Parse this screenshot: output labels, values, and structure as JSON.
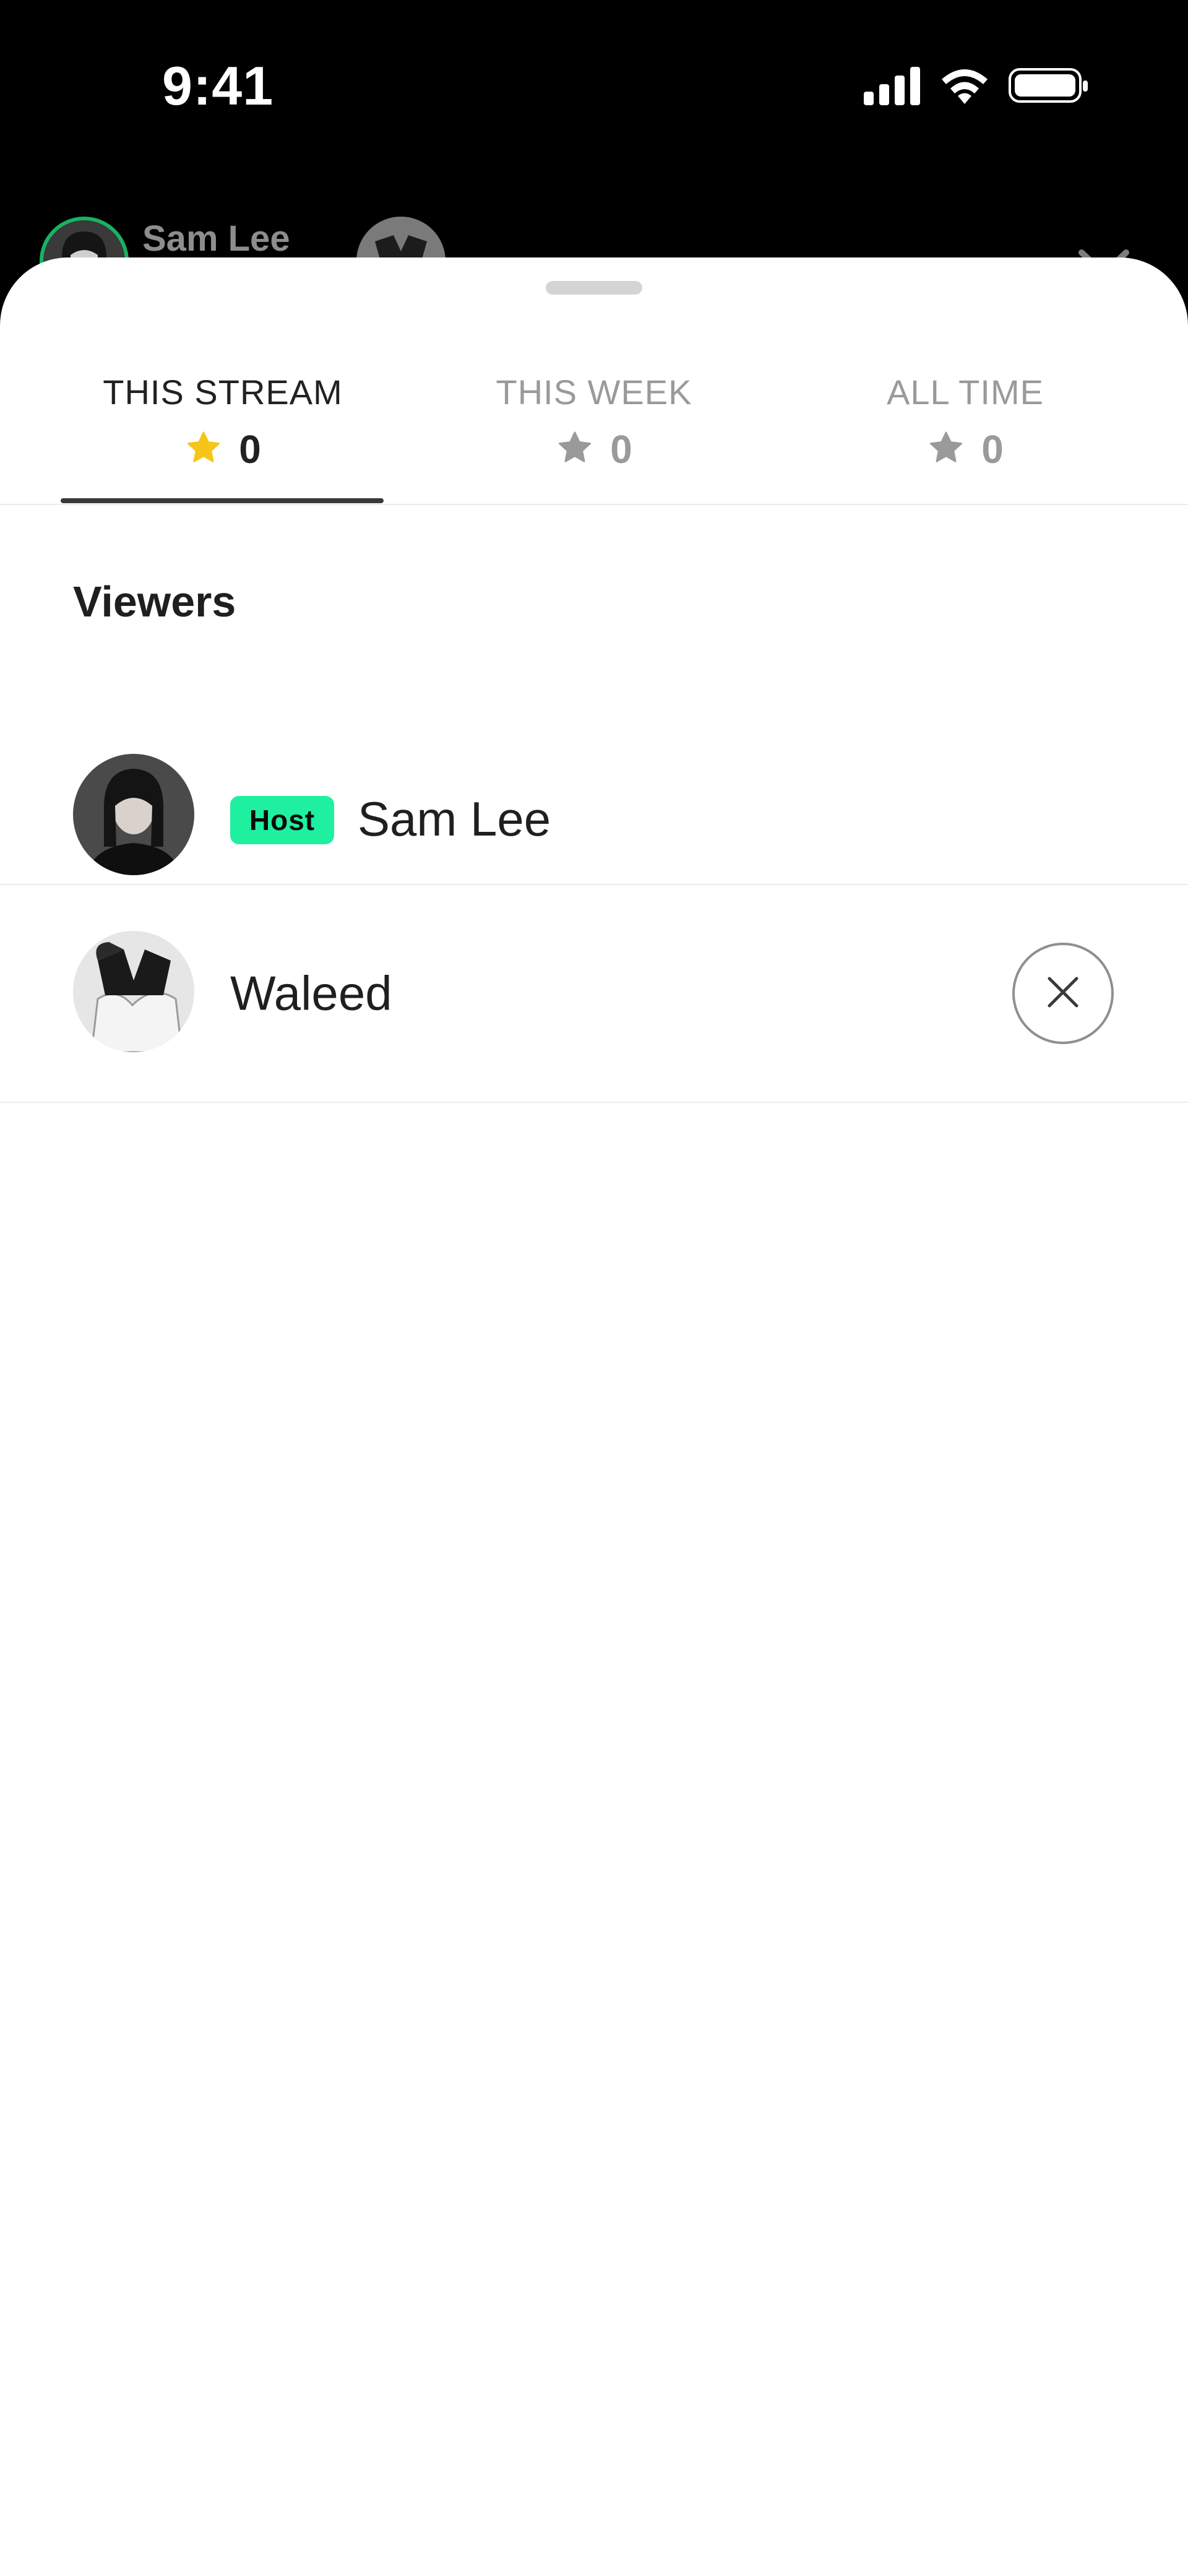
{
  "status_bar": {
    "time": "9:41",
    "icons": [
      "cellular-signal-icon",
      "wifi-icon",
      "battery-icon"
    ]
  },
  "background_stream": {
    "host_name": "Sam Lee",
    "close_icon": "chevron-down-icon"
  },
  "sheet": {
    "tabs": [
      {
        "label": "THIS STREAM",
        "count": "0",
        "active": true
      },
      {
        "label": "THIS WEEK",
        "count": "0",
        "active": false
      },
      {
        "label": "ALL TIME",
        "count": "0",
        "active": false
      }
    ],
    "section_title": "Viewers",
    "viewers": [
      {
        "name": "Sam Lee",
        "badge": "Host"
      },
      {
        "name": "Waleed",
        "action_icon": "close-icon"
      }
    ]
  },
  "colors": {
    "accent_star_active": "#F5C518",
    "star_inactive": "#9A9A9A",
    "host_badge": "#1EF0A0",
    "host_ring": "#18B35F"
  }
}
